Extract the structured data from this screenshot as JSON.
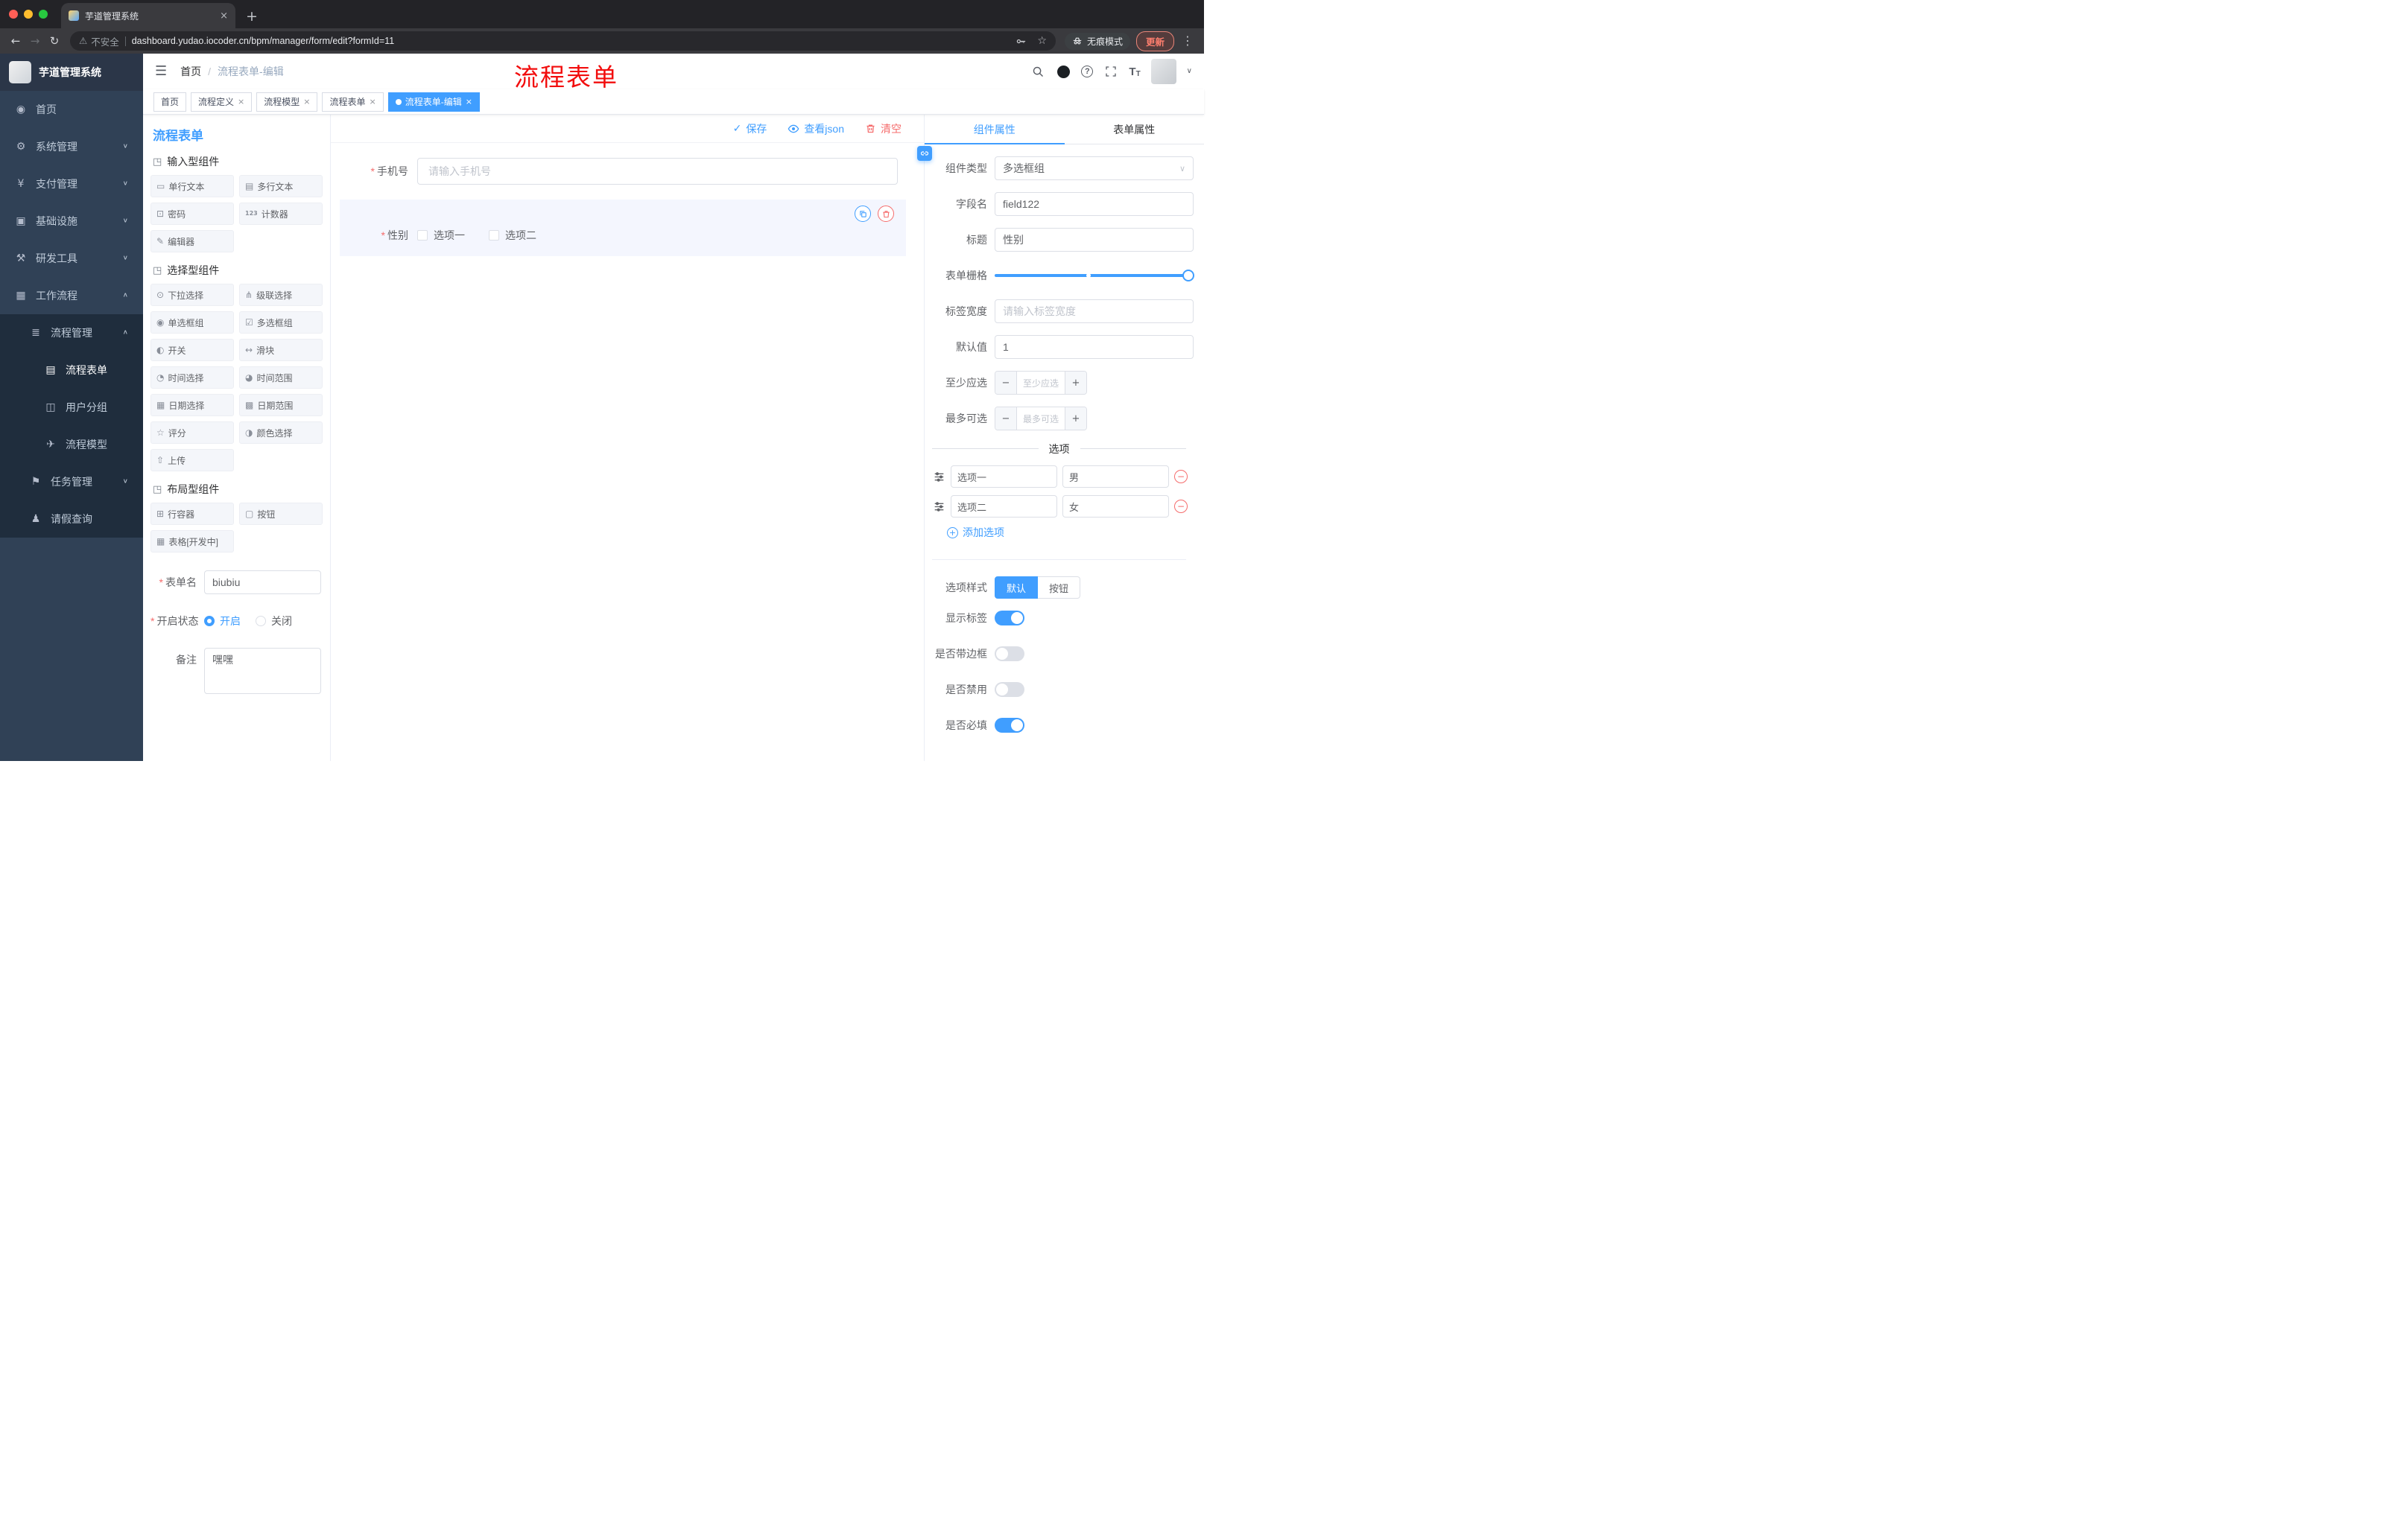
{
  "browser": {
    "tab_title": "芋道管理系统",
    "close": "×",
    "new_tab": "+",
    "back": "←",
    "forward": "→",
    "reload": "↻",
    "warning": "⚠",
    "security": "不安全",
    "url": "dashboard.yudao.iocoder.cn/bpm/manager/form/edit?formId=11",
    "star": "☆",
    "incognito": "无痕模式",
    "update": "更新",
    "dots": "⋮"
  },
  "sidebar": {
    "title": "芋道管理系统",
    "items": [
      {
        "icon": "◉",
        "label": "首页"
      },
      {
        "icon": "⚙",
        "label": "系统管理",
        "chevron": "∨"
      },
      {
        "icon": "¥",
        "label": "支付管理",
        "chevron": "∨"
      },
      {
        "icon": "▣",
        "label": "基础设施",
        "chevron": "∨"
      },
      {
        "icon": "⚒",
        "label": "研发工具",
        "chevron": "∨"
      },
      {
        "icon": "▦",
        "label": "工作流程",
        "chevron": "∧"
      },
      {
        "icon": "≣",
        "label": "流程管理",
        "chevron": "∧"
      },
      {
        "icon": "▤",
        "label": "流程表单"
      },
      {
        "icon": "◫",
        "label": "用户分组"
      },
      {
        "icon": "✈",
        "label": "流程模型"
      },
      {
        "icon": "⚑",
        "label": "任务管理",
        "chevron": "∨"
      },
      {
        "icon": "♟",
        "label": "请假查询"
      }
    ]
  },
  "header": {
    "hamburger": "☰",
    "breadcrumb": {
      "home": "首页",
      "sep": "/",
      "current": "流程表单-编辑"
    },
    "annotation": "流程表单",
    "question": "?",
    "caret": "∨"
  },
  "tags": [
    {
      "label": "首页"
    },
    {
      "label": "流程定义",
      "close": "×"
    },
    {
      "label": "流程模型",
      "close": "×"
    },
    {
      "label": "流程表单",
      "close": "×"
    },
    {
      "label": "流程表单-编辑",
      "close": "×"
    }
  ],
  "palette": {
    "title": "流程表单",
    "groups": [
      {
        "icon": "◳",
        "title": "输入型组件",
        "items": [
          {
            "icon": "▭",
            "label": "单行文本"
          },
          {
            "icon": "▤",
            "label": "多行文本"
          },
          {
            "icon": "⊡",
            "label": "密码"
          },
          {
            "icon": "123",
            "label": "计数器"
          },
          {
            "icon": "✎",
            "label": "编辑器"
          }
        ]
      },
      {
        "icon": "◳",
        "title": "选择型组件",
        "items": [
          {
            "icon": "⊙",
            "label": "下拉选择"
          },
          {
            "icon": "⋔",
            "label": "级联选择"
          },
          {
            "icon": "◉",
            "label": "单选框组"
          },
          {
            "icon": "☑",
            "label": "多选框组"
          },
          {
            "icon": "◐",
            "label": "开关"
          },
          {
            "icon": "↔",
            "label": "滑块"
          },
          {
            "icon": "◔",
            "label": "时间选择"
          },
          {
            "icon": "◕",
            "label": "时间范围"
          },
          {
            "icon": "▦",
            "label": "日期选择"
          },
          {
            "icon": "▩",
            "label": "日期范围"
          },
          {
            "icon": "☆",
            "label": "评分"
          },
          {
            "icon": "◑",
            "label": "颜色选择"
          },
          {
            "icon": "⇧",
            "label": "上传"
          }
        ]
      },
      {
        "icon": "◳",
        "title": "布局型组件",
        "items": [
          {
            "icon": "⊞",
            "label": "行容器"
          },
          {
            "icon": "▢",
            "label": "按钮"
          },
          {
            "icon": "▦",
            "label": "表格[开发中]"
          }
        ]
      }
    ],
    "form": {
      "name_label": "表单名",
      "name_value": "biubiu",
      "status_label": "开启状态",
      "status_on": "开启",
      "status_off": "关闭",
      "remark_label": "备注",
      "remark_value": "嘿嘿"
    }
  },
  "canvas": {
    "check": "✓",
    "save": "保存",
    "view_json": "查看json",
    "clear": "清空",
    "phone": {
      "label": "手机号",
      "placeholder": "请输入手机号"
    },
    "gender": {
      "label": "性别",
      "option1": "选项一",
      "option2": "选项二"
    }
  },
  "inspector": {
    "tab_component": "组件属性",
    "tab_form": "表单属性",
    "rows": {
      "type_label": "组件类型",
      "type_value": "多选框组",
      "type_chevron": "∨",
      "field_label": "字段名",
      "field_value": "field122",
      "title_label": "标题",
      "title_value": "性别",
      "grid_label": "表单栅格",
      "width_label": "标签宽度",
      "width_placeholder": "请输入标签宽度",
      "default_label": "默认值",
      "default_value": "1",
      "min_label": "至少应选",
      "min_placeholder": "至少应选",
      "max_label": "最多可选",
      "max_placeholder": "最多可选"
    },
    "stepper_minus": "−",
    "stepper_plus": "+",
    "options_title": "选项",
    "options": [
      {
        "label": "选项一",
        "value": "男"
      },
      {
        "label": "选项二",
        "value": "女"
      }
    ],
    "remove_glyph": "−",
    "add_glyph": "+",
    "add_option": "添加选项",
    "style_label": "选项样式",
    "style_default": "默认",
    "style_button": "按钮",
    "toggles": [
      {
        "label": "显示标签",
        "on": true
      },
      {
        "label": "是否带边框",
        "on": false
      },
      {
        "label": "是否禁用",
        "on": false
      },
      {
        "label": "是否必填",
        "on": true
      }
    ]
  },
  "colors": {
    "accent": "#409eff",
    "danger": "#f56c6c",
    "sidebar": "#304156",
    "submenu": "#1f2d3d",
    "annotation_red": "#f20d0d"
  }
}
